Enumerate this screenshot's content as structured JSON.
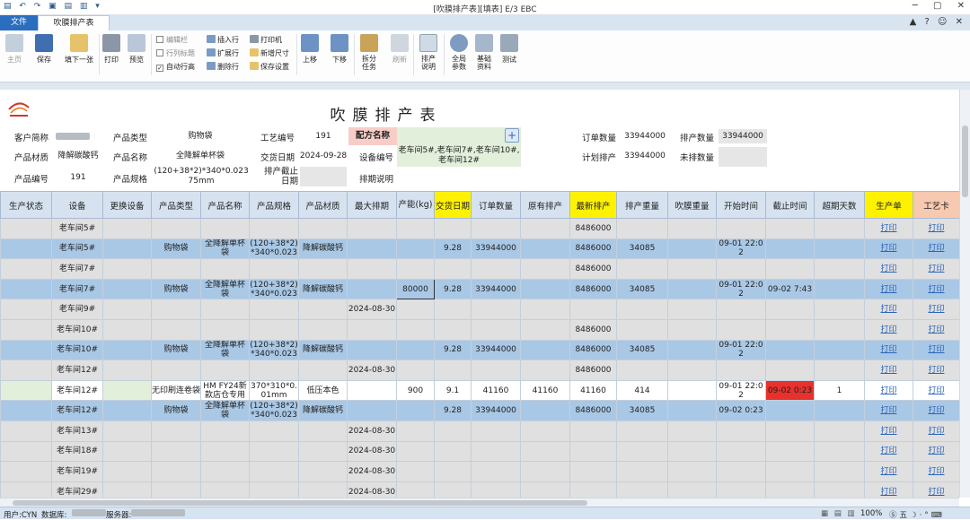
{
  "window": {
    "title": "[吹膜排产表][填表]   E/3 EBC",
    "controls": "─ ▢ ✕",
    "tab_right_icons": "▲ ? ☺ ✕"
  },
  "tabs": {
    "file": "文件",
    "main": "吹膜排产表"
  },
  "ribbon": {
    "home": "主页",
    "save": "保存",
    "fill_next": "填下一张",
    "print": "打印",
    "preview": "预览",
    "edit_bar": "编辑栏",
    "row_title": "行列标题",
    "auto_row_height": "自动行高",
    "insert_row": "插入行",
    "expand_row": "扩展行",
    "delete_row": "删除行",
    "printer": "打印机",
    "new_size": "新增尺寸",
    "save_settings": "保存设置",
    "move_up": "上移",
    "move_down": "下移",
    "split_task": "拆分任务",
    "refresh": "刷新",
    "schedule_note": "排产说明",
    "global_params": "全局参数",
    "basic_data": "基础资料",
    "test": "测试"
  },
  "form": {
    "title": "吹膜排产表",
    "customer_label": "客户简称",
    "product_type_label": "产品类型",
    "product_type": "购物袋",
    "process_no_label": "工艺编号",
    "process_no": "191",
    "formula_label": "配方名称",
    "order_qty_label": "订单数量",
    "order_qty": "33944000",
    "scheduled_qty_label": "排产数量",
    "scheduled_qty": "33944000",
    "material_label": "产品材质",
    "material": "降解碳酸钙",
    "product_name_label": "产品名称",
    "product_name": "全降解单杯袋",
    "delivery_label": "交货日期",
    "delivery": "2024-09-28",
    "equipment_label": "设备编号",
    "equipment": "老车间5#,老车间7#,老车间10#,老车间12#",
    "plan_label": "计划排产",
    "plan_qty": "33944000",
    "unscheduled_label": "未排数量",
    "product_no_label": "产品编号",
    "product_no": "191",
    "spec_label": "产品规格",
    "spec": "(120+38*2)*340*0.023 75mm",
    "deadline_label": "排产截止日期",
    "note_label": "排期说明",
    "add_button": "+"
  },
  "table": {
    "headers": [
      "生产状态",
      "设备",
      "更换设备",
      "产品类型",
      "产品名称",
      "产品规格",
      "产品材质",
      "最大排期",
      "产能(kg)",
      "交货日期",
      "订单数量",
      "原有排产",
      "最新排产",
      "排产重量",
      "吹膜重量",
      "开始时间",
      "截止时间",
      "超期天数",
      "生产单",
      "工艺卡"
    ],
    "rows": [
      {
        "style": "g",
        "cells": [
          "",
          "老车间5#",
          "",
          "",
          "",
          "",
          "",
          "",
          "",
          "",
          "",
          "",
          "8486000",
          "",
          "",
          "",
          "",
          "",
          "打印",
          "打印"
        ]
      },
      {
        "style": "b",
        "cells": [
          "",
          "老车间5#",
          "",
          "购物袋",
          "全降解单杯袋",
          "(120+38*2)*340*0.023",
          "降解碳酸钙",
          "",
          "",
          "9.28",
          "33944000",
          "",
          "8486000",
          "34085",
          "",
          "09-01 22:02",
          "",
          "",
          "打印",
          "打印"
        ]
      },
      {
        "style": "g",
        "cells": [
          "",
          "老车间7#",
          "",
          "",
          "",
          "",
          "",
          "",
          "",
          "",
          "",
          "",
          "8486000",
          "",
          "",
          "",
          "",
          "",
          "打印",
          "打印"
        ]
      },
      {
        "style": "b",
        "cells": [
          "",
          "老车间7#",
          "",
          "购物袋",
          "全降解单杯袋",
          "(120+38*2)*340*0.023",
          "降解碳酸钙",
          "",
          "80000",
          "9.28",
          "33944000",
          "",
          "8486000",
          "34085",
          "",
          "09-01 22:02",
          "09-02 7:43",
          "",
          "打印",
          "打印"
        ]
      },
      {
        "style": "g",
        "cells": [
          "",
          "老车间9#",
          "",
          "",
          "",
          "",
          "",
          "2024-08-30",
          "",
          "",
          "",
          "",
          "",
          "",
          "",
          "",
          "",
          "",
          "打印",
          "打印"
        ]
      },
      {
        "style": "g",
        "cells": [
          "",
          "老车间10#",
          "",
          "",
          "",
          "",
          "",
          "",
          "",
          "",
          "",
          "",
          "8486000",
          "",
          "",
          "",
          "",
          "",
          "打印",
          "打印"
        ]
      },
      {
        "style": "b",
        "cells": [
          "",
          "老车间10#",
          "",
          "购物袋",
          "全降解单杯袋",
          "(120+38*2)*340*0.023",
          "降解碳酸钙",
          "",
          "",
          "9.28",
          "33944000",
          "",
          "8486000",
          "34085",
          "",
          "09-01 22:02",
          "",
          "",
          "打印",
          "打印"
        ]
      },
      {
        "style": "g",
        "cells": [
          "",
          "老车间12#",
          "",
          "",
          "",
          "",
          "",
          "2024-08-30",
          "",
          "",
          "",
          "",
          "8486000",
          "",
          "",
          "",
          "",
          "",
          "打印",
          "打印"
        ]
      },
      {
        "style": "w",
        "cells": [
          "",
          "老车间12#",
          "",
          "无印刷连卷袋",
          "HM FY24新款店仓专用",
          "370*310*0.01mm",
          "低压本色",
          "",
          "900",
          "9.1",
          "41160",
          "41160",
          "41160",
          "414",
          "",
          "09-01 22:02",
          "09-02 0:23",
          "1",
          "打印",
          "打印"
        ]
      },
      {
        "style": "b",
        "cells": [
          "",
          "老车间12#",
          "",
          "购物袋",
          "全降解单杯袋",
          "(120+38*2)*340*0.023",
          "降解碳酸钙",
          "",
          "",
          "9.28",
          "33944000",
          "",
          "8486000",
          "34085",
          "",
          "09-02 0:23",
          "",
          "",
          "打印",
          "打印"
        ]
      },
      {
        "style": "g",
        "cells": [
          "",
          "老车间13#",
          "",
          "",
          "",
          "",
          "",
          "2024-08-30",
          "",
          "",
          "",
          "",
          "",
          "",
          "",
          "",
          "",
          "",
          "打印",
          "打印"
        ]
      },
      {
        "style": "g",
        "cells": [
          "",
          "老车间18#",
          "",
          "",
          "",
          "",
          "",
          "2024-08-30",
          "",
          "",
          "",
          "",
          "",
          "",
          "",
          "",
          "",
          "",
          "打印",
          "打印"
        ]
      },
      {
        "style": "g",
        "cells": [
          "",
          "老车间19#",
          "",
          "",
          "",
          "",
          "",
          "2024-08-30",
          "",
          "",
          "",
          "",
          "",
          "",
          "",
          "",
          "",
          "",
          "打印",
          "打印"
        ]
      },
      {
        "style": "g",
        "cells": [
          "",
          "老车间29#",
          "",
          "",
          "",
          "",
          "",
          "2024-08-30",
          "",
          "",
          "",
          "",
          "",
          "",
          "",
          "",
          "",
          "",
          "打印",
          "打印"
        ]
      }
    ]
  },
  "status": {
    "user": "用户:CYN",
    "db": "数据库:",
    "server": "服务器:",
    "right": "100%"
  },
  "colors": {
    "header_yellow": "#fff200",
    "header_pink": "#f7c9b0",
    "header_red": "#f8cdc8",
    "link": "#2b64b8",
    "overdue": "#e8302c"
  }
}
